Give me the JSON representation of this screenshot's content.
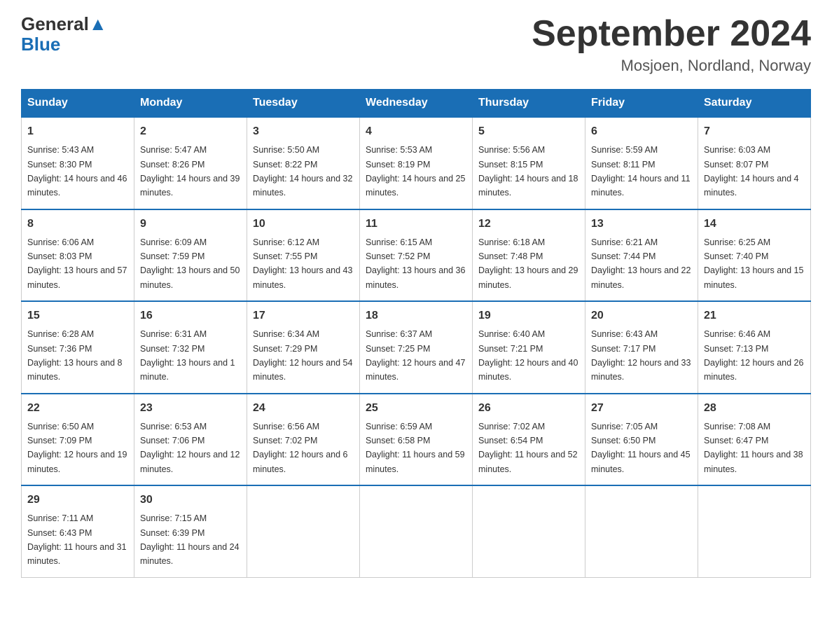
{
  "header": {
    "logo_text_general": "General",
    "logo_text_blue": "Blue",
    "calendar_title": "September 2024",
    "calendar_subtitle": "Mosjoen, Nordland, Norway"
  },
  "weekdays": [
    "Sunday",
    "Monday",
    "Tuesday",
    "Wednesday",
    "Thursday",
    "Friday",
    "Saturday"
  ],
  "weeks": [
    [
      {
        "day": "1",
        "sunrise": "5:43 AM",
        "sunset": "8:30 PM",
        "daylight": "14 hours and 46 minutes."
      },
      {
        "day": "2",
        "sunrise": "5:47 AM",
        "sunset": "8:26 PM",
        "daylight": "14 hours and 39 minutes."
      },
      {
        "day": "3",
        "sunrise": "5:50 AM",
        "sunset": "8:22 PM",
        "daylight": "14 hours and 32 minutes."
      },
      {
        "day": "4",
        "sunrise": "5:53 AM",
        "sunset": "8:19 PM",
        "daylight": "14 hours and 25 minutes."
      },
      {
        "day": "5",
        "sunrise": "5:56 AM",
        "sunset": "8:15 PM",
        "daylight": "14 hours and 18 minutes."
      },
      {
        "day": "6",
        "sunrise": "5:59 AM",
        "sunset": "8:11 PM",
        "daylight": "14 hours and 11 minutes."
      },
      {
        "day": "7",
        "sunrise": "6:03 AM",
        "sunset": "8:07 PM",
        "daylight": "14 hours and 4 minutes."
      }
    ],
    [
      {
        "day": "8",
        "sunrise": "6:06 AM",
        "sunset": "8:03 PM",
        "daylight": "13 hours and 57 minutes."
      },
      {
        "day": "9",
        "sunrise": "6:09 AM",
        "sunset": "7:59 PM",
        "daylight": "13 hours and 50 minutes."
      },
      {
        "day": "10",
        "sunrise": "6:12 AM",
        "sunset": "7:55 PM",
        "daylight": "13 hours and 43 minutes."
      },
      {
        "day": "11",
        "sunrise": "6:15 AM",
        "sunset": "7:52 PM",
        "daylight": "13 hours and 36 minutes."
      },
      {
        "day": "12",
        "sunrise": "6:18 AM",
        "sunset": "7:48 PM",
        "daylight": "13 hours and 29 minutes."
      },
      {
        "day": "13",
        "sunrise": "6:21 AM",
        "sunset": "7:44 PM",
        "daylight": "13 hours and 22 minutes."
      },
      {
        "day": "14",
        "sunrise": "6:25 AM",
        "sunset": "7:40 PM",
        "daylight": "13 hours and 15 minutes."
      }
    ],
    [
      {
        "day": "15",
        "sunrise": "6:28 AM",
        "sunset": "7:36 PM",
        "daylight": "13 hours and 8 minutes."
      },
      {
        "day": "16",
        "sunrise": "6:31 AM",
        "sunset": "7:32 PM",
        "daylight": "13 hours and 1 minute."
      },
      {
        "day": "17",
        "sunrise": "6:34 AM",
        "sunset": "7:29 PM",
        "daylight": "12 hours and 54 minutes."
      },
      {
        "day": "18",
        "sunrise": "6:37 AM",
        "sunset": "7:25 PM",
        "daylight": "12 hours and 47 minutes."
      },
      {
        "day": "19",
        "sunrise": "6:40 AM",
        "sunset": "7:21 PM",
        "daylight": "12 hours and 40 minutes."
      },
      {
        "day": "20",
        "sunrise": "6:43 AM",
        "sunset": "7:17 PM",
        "daylight": "12 hours and 33 minutes."
      },
      {
        "day": "21",
        "sunrise": "6:46 AM",
        "sunset": "7:13 PM",
        "daylight": "12 hours and 26 minutes."
      }
    ],
    [
      {
        "day": "22",
        "sunrise": "6:50 AM",
        "sunset": "7:09 PM",
        "daylight": "12 hours and 19 minutes."
      },
      {
        "day": "23",
        "sunrise": "6:53 AM",
        "sunset": "7:06 PM",
        "daylight": "12 hours and 12 minutes."
      },
      {
        "day": "24",
        "sunrise": "6:56 AM",
        "sunset": "7:02 PM",
        "daylight": "12 hours and 6 minutes."
      },
      {
        "day": "25",
        "sunrise": "6:59 AM",
        "sunset": "6:58 PM",
        "daylight": "11 hours and 59 minutes."
      },
      {
        "day": "26",
        "sunrise": "7:02 AM",
        "sunset": "6:54 PM",
        "daylight": "11 hours and 52 minutes."
      },
      {
        "day": "27",
        "sunrise": "7:05 AM",
        "sunset": "6:50 PM",
        "daylight": "11 hours and 45 minutes."
      },
      {
        "day": "28",
        "sunrise": "7:08 AM",
        "sunset": "6:47 PM",
        "daylight": "11 hours and 38 minutes."
      }
    ],
    [
      {
        "day": "29",
        "sunrise": "7:11 AM",
        "sunset": "6:43 PM",
        "daylight": "11 hours and 31 minutes."
      },
      {
        "day": "30",
        "sunrise": "7:15 AM",
        "sunset": "6:39 PM",
        "daylight": "11 hours and 24 minutes."
      },
      null,
      null,
      null,
      null,
      null
    ]
  ],
  "labels": {
    "sunrise_prefix": "Sunrise: ",
    "sunset_prefix": "Sunset: ",
    "daylight_prefix": "Daylight: "
  }
}
